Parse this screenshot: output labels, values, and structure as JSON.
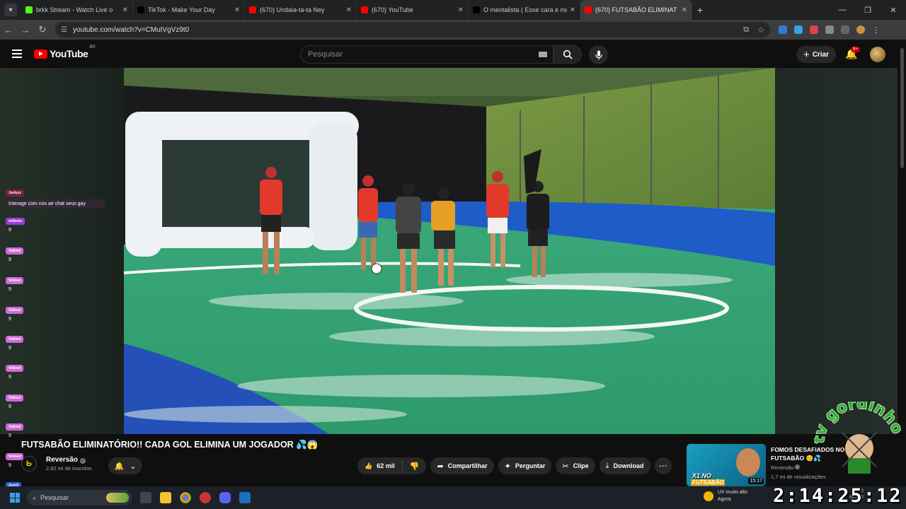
{
  "browser": {
    "tabs": [
      {
        "title": "brkk Stream - Watch Live o",
        "favicon": "kick-icon",
        "color": "#53fc18",
        "active": false
      },
      {
        "title": "TikTok - Make Your Day",
        "favicon": "tiktok-icon",
        "color": "#000000",
        "active": false
      },
      {
        "title": "(670) Undaia-ta-ta Ney",
        "favicon": "youtube-icon",
        "color": "#ff0000",
        "active": false
      },
      {
        "title": "(670) YouTube",
        "favicon": "youtube-icon",
        "color": "#ff0000",
        "active": false
      },
      {
        "title": "O mentalista ( Esse cara é mui",
        "favicon": "tiktok-icon",
        "color": "#000000",
        "active": false
      },
      {
        "title": "(670) FUTSABÃO ELIMINAT",
        "favicon": "youtube-icon",
        "color": "#ff0000",
        "active": true
      }
    ],
    "url": "youtube.com/watch?v=CMutVgVz9t0"
  },
  "youtube": {
    "logo_text": "YouTube",
    "region": "BR",
    "search_placeholder": "Pesquisar",
    "create_label": "Criar",
    "notif_badge": "9+"
  },
  "chat": [
    {
      "name": "Justyzz",
      "text": "Interage com nos ae chat seus gay",
      "color": "#7a2040"
    },
    {
      "name": "milboku",
      "text": "9",
      "color": "#9b3ed4"
    },
    {
      "name": "Volbeel",
      "text": "9",
      "color": "#d06ad8"
    },
    {
      "name": "Volbeel",
      "text": "9",
      "color": "#d06ad8"
    },
    {
      "name": "Volbeel",
      "text": "9",
      "color": "#d06ad8"
    },
    {
      "name": "Volbeel",
      "text": "9",
      "color": "#d06ad8"
    },
    {
      "name": "Volbeel",
      "text": "9",
      "color": "#d06ad8"
    },
    {
      "name": "Volbeel",
      "text": "9",
      "color": "#d06ad8"
    },
    {
      "name": "Volbeel",
      "text": "9",
      "color": "#d06ad8"
    },
    {
      "name": "Volbeel",
      "text": "9",
      "color": "#d06ad8"
    },
    {
      "name": "ZeroX",
      "text": "",
      "color": "#2a63d8"
    }
  ],
  "video": {
    "title": "FUTSABÃO ELIMINATÓRIO!! CADA GOL ELIMINA UM JOGADOR 💦😱",
    "channel": "Reversão",
    "subscribers": "2,82 mi de inscritos",
    "likes": "62 mil",
    "share": "Compartilhar",
    "ask": "Perguntar",
    "clip": "Clipe",
    "download": "Download"
  },
  "recommendation": {
    "title": "FOMOS DESAFIADOS NO X1 DE FUTSABÃO 😊💦",
    "channel": "Reversão",
    "views": "1,7 mi de visualizações",
    "duration": "15:17",
    "thumb_line1": "X1 NO",
    "thumb_line2": "FUTSABÃO"
  },
  "taskbar": {
    "search_placeholder": "Pesquisar",
    "weather_text": "UV muito alto",
    "weather_sub": "Agora",
    "tray_time": "12",
    "tray_date": "/07/202"
  },
  "overlay": {
    "clock": "2:14:25:12",
    "watermark": "tv gordinho"
  }
}
